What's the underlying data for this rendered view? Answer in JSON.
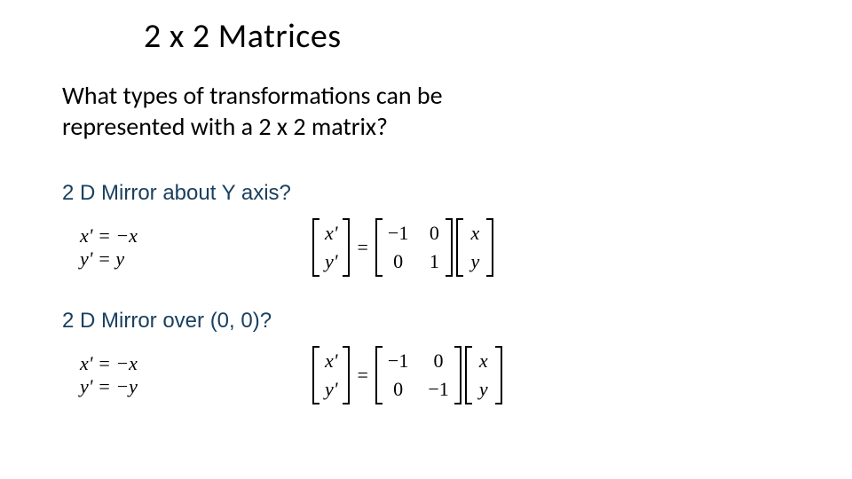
{
  "title": "2 x 2 Matrices",
  "subtitle_line1": "What types of transformations can be",
  "subtitle_line2": "represented with a 2 x 2 matrix?",
  "sections": [
    {
      "label": "2 D Mirror about Y axis?",
      "equations": {
        "scalar": [
          "x' = −x",
          "y' = y"
        ],
        "lhs": [
          "x'",
          "y'"
        ],
        "matrix": [
          [
            "−1",
            "0"
          ],
          [
            "0",
            "1"
          ]
        ],
        "rhs": [
          "x",
          "y"
        ]
      }
    },
    {
      "label": "2 D Mirror over (0, 0)?",
      "equations": {
        "scalar": [
          "x' = −x",
          "y' = −y"
        ],
        "lhs": [
          "x'",
          "y'"
        ],
        "matrix": [
          [
            "−1",
            "0"
          ],
          [
            "0",
            "−1"
          ]
        ],
        "rhs": [
          "x",
          "y"
        ]
      }
    }
  ]
}
